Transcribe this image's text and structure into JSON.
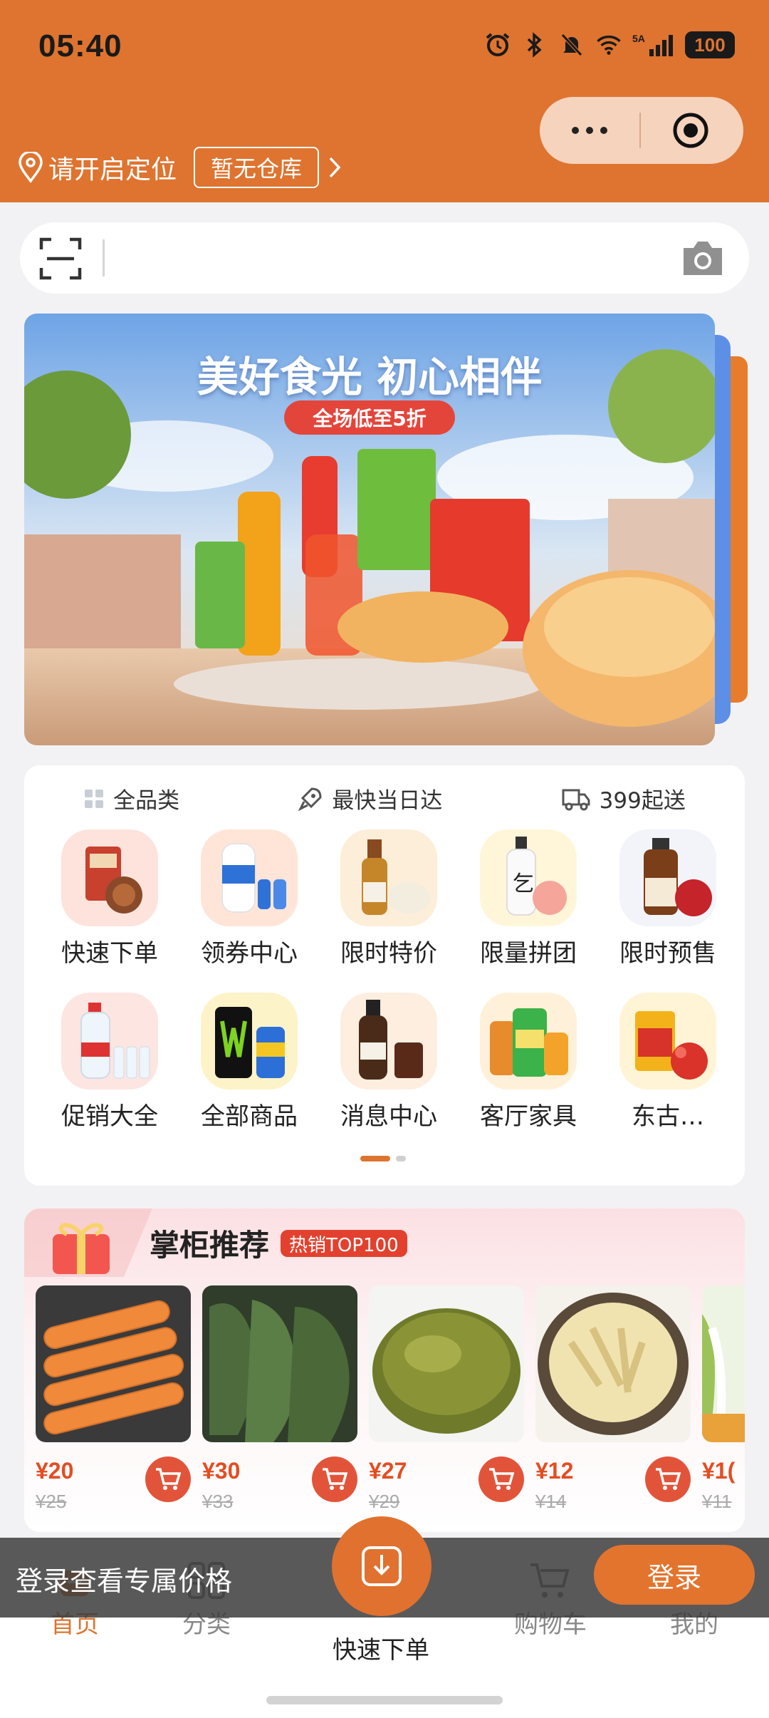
{
  "status": {
    "time": "05:40",
    "network": "5A",
    "battery": "100"
  },
  "header": {
    "location": "请开启定位",
    "warehouse": "暂无仓库"
  },
  "search": {
    "placeholder": ""
  },
  "banner": {
    "title": "美好食光 初心相伴",
    "subtitle": "全场低至5折"
  },
  "features": [
    {
      "label": "全品类",
      "icon": "grid-icon"
    },
    {
      "label": "最快当日达",
      "icon": "rocket-icon"
    },
    {
      "label": "399起送",
      "icon": "truck-icon"
    }
  ],
  "categories": [
    {
      "label": "快速下单"
    },
    {
      "label": "领券中心"
    },
    {
      "label": "限时特价"
    },
    {
      "label": "限量拼团"
    },
    {
      "label": "限时预售"
    },
    {
      "label": "促销大全"
    },
    {
      "label": "全部商品"
    },
    {
      "label": "消息中心"
    },
    {
      "label": "客厅家具"
    },
    {
      "label": "东古…"
    }
  ],
  "recommend": {
    "title": "掌柜推荐",
    "badge": "热销TOP100",
    "products": [
      {
        "price": "¥20",
        "old": "¥25"
      },
      {
        "price": "¥30",
        "old": "¥33"
      },
      {
        "price": "¥27",
        "old": "¥29"
      },
      {
        "price": "¥12",
        "old": "¥14"
      },
      {
        "price": "¥1(",
        "old": "¥11"
      }
    ]
  },
  "tabs": [
    {
      "label": "首页"
    },
    {
      "label": "分类"
    },
    {
      "label": "快速下单"
    },
    {
      "label": "购物车"
    },
    {
      "label": "我的"
    }
  ],
  "login": {
    "text": "登录查看专属价格",
    "button": "登录"
  },
  "colors": {
    "brand": "#de7430",
    "price": "#e34d22",
    "badge": "#e2412f"
  }
}
